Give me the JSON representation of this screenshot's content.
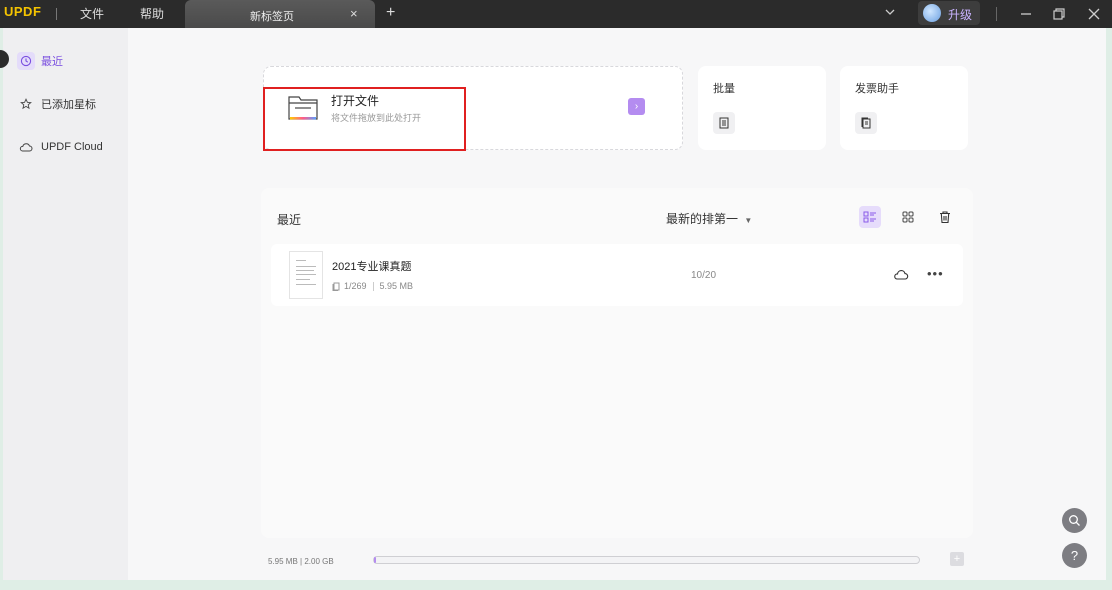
{
  "app": {
    "logo": "UPDF",
    "logo_colors": [
      "#f5c400",
      "#f5c400",
      "#ff6a6a",
      "#7aa7ff"
    ],
    "accent": "#b48cf0"
  },
  "menu": {
    "file": "文件",
    "help": "帮助"
  },
  "tab": {
    "label": "新标签页",
    "close": "×",
    "add": "+"
  },
  "upgrade": {
    "label": "升级"
  },
  "sidebar": {
    "items": [
      {
        "label": "最近",
        "icon": "clock-icon"
      },
      {
        "label": "已添加星标",
        "icon": "star-icon"
      },
      {
        "label": "UPDF Cloud",
        "icon": "cloud-icon"
      }
    ]
  },
  "open_file": {
    "title": "打开文件",
    "subtitle": "将文件拖放到此处打开",
    "arrow": "›"
  },
  "batch": {
    "title": "批量"
  },
  "invoice": {
    "title": "发票助手"
  },
  "recent": {
    "title": "最近",
    "sort": "最新的排第一",
    "files": [
      {
        "name": "2021专业课真题",
        "pages": "1/269",
        "size": "5.95 MB",
        "progress": "10/20"
      }
    ]
  },
  "storage": {
    "text": "5.95 MB | 2.00 GB",
    "used_fraction": 0.003,
    "add": "+"
  },
  "float": {
    "search_icon": "search-icon",
    "help": "?"
  }
}
